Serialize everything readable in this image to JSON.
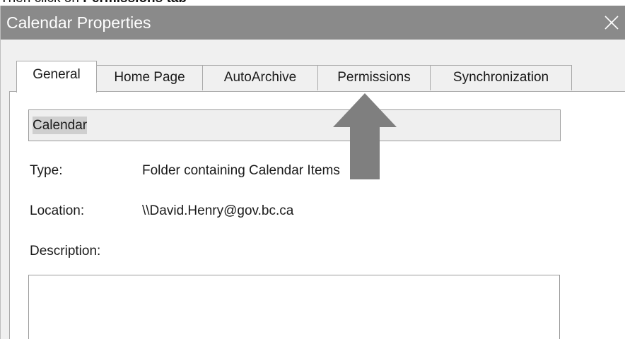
{
  "instruction": {
    "prefix": "Then click on ",
    "emphasis": "Permissions tab"
  },
  "dialog": {
    "title": "Calendar Properties",
    "close_icon": "close-icon",
    "tabs": [
      {
        "label": "General",
        "active": true
      },
      {
        "label": "Home Page",
        "active": false
      },
      {
        "label": "AutoArchive",
        "active": false
      },
      {
        "label": "Permissions",
        "active": false
      },
      {
        "label": "Synchronization",
        "active": false
      }
    ],
    "name_value": "Calendar",
    "type_label": "Type:",
    "type_value": "Folder containing Calendar Items",
    "location_label": "Location:",
    "location_value": "\\\\David.Henry@gov.bc.ca",
    "description_label": "Description:",
    "description_value": ""
  },
  "annotation": {
    "arrow_icon": "up-arrow-icon",
    "arrow_color": "#7f7f7f",
    "points_to": "Permissions"
  },
  "colors": {
    "titlebar": "#8a8a8a",
    "dialog_bg": "#f0f0f0",
    "selection": "#cfcfcf"
  }
}
